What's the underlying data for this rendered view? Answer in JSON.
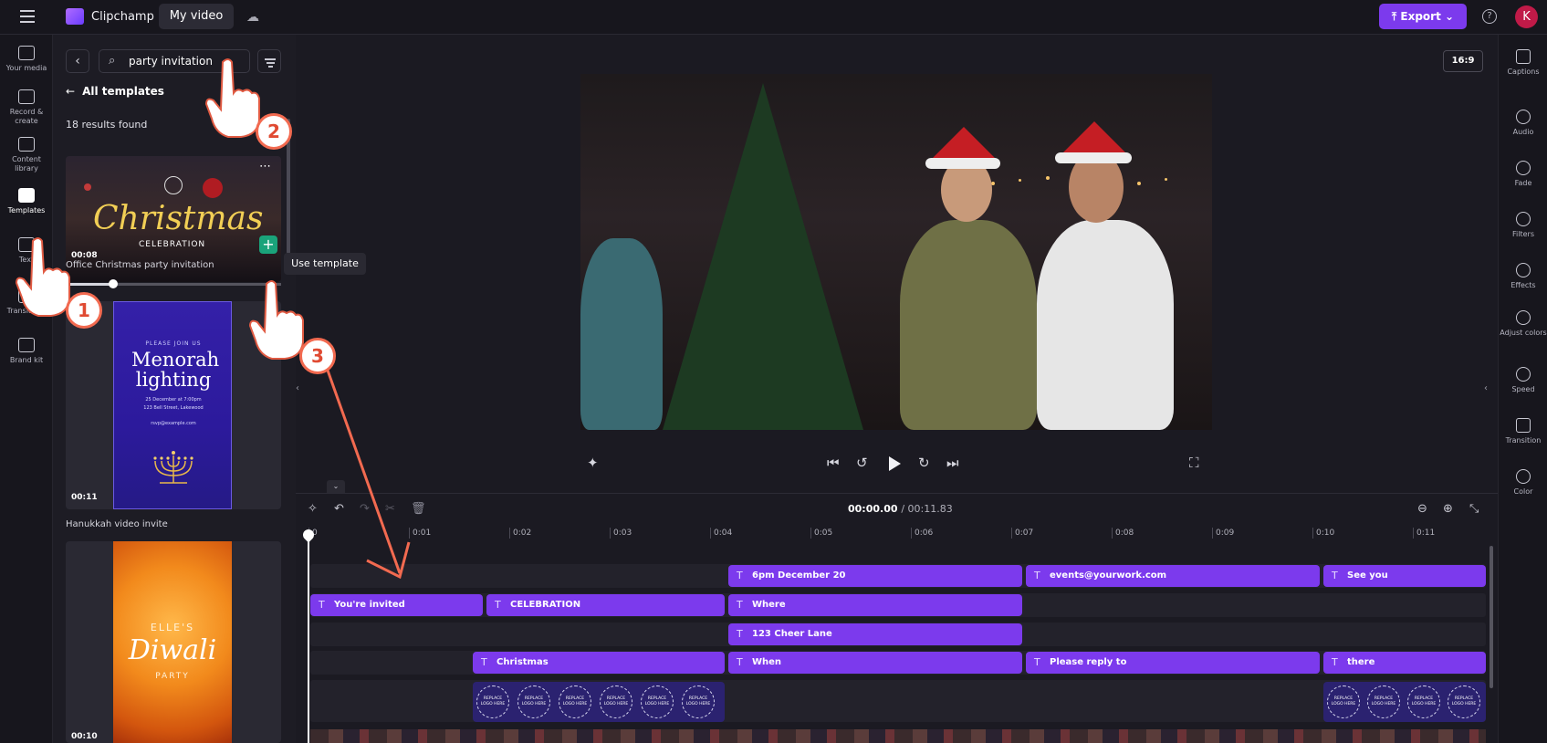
{
  "app": {
    "name": "Clipchamp",
    "project_title": "My video",
    "export_label": "Export",
    "avatar_initial": "K",
    "brand_color": "#7c3aed"
  },
  "left_rail": [
    {
      "label": "Your media"
    },
    {
      "label": "Record & create"
    },
    {
      "label": "Content library"
    },
    {
      "label": "Templates"
    },
    {
      "label": "Text"
    },
    {
      "label": "Transitions"
    },
    {
      "label": "Brand kit"
    }
  ],
  "panel": {
    "search_value": "party invitation",
    "all_templates": "All templates",
    "results": "18 results found",
    "use_template_tooltip": "Use template",
    "cards": [
      {
        "duration": "00:08",
        "label": "Office Christmas party invitation",
        "art_title": "Christmas",
        "art_subtitle": "CELEBRATION",
        "progress": 0.22
      },
      {
        "duration": "00:11",
        "label": "Hanukkah video invite",
        "art_please": "PLEASE JOIN US",
        "art_title": "Menorah lighting",
        "art_line1": "25 December at 7:00pm",
        "art_line2": "123 Bell Street, Lakewood",
        "art_line3": "rsvp@example.com"
      },
      {
        "duration": "00:10",
        "art_top": "ELLE'S",
        "art_title": "Diwali",
        "art_bottom": "PARTY"
      }
    ]
  },
  "preview": {
    "ratio": "16:9"
  },
  "right_rail": [
    {
      "label": "Captions"
    },
    {
      "label": "Audio"
    },
    {
      "label": "Fade"
    },
    {
      "label": "Filters"
    },
    {
      "label": "Effects"
    },
    {
      "label": "Adjust colors"
    },
    {
      "label": "Speed"
    },
    {
      "label": "Transition"
    },
    {
      "label": "Color"
    }
  ],
  "timeline": {
    "current": "00:00.00",
    "total": "/ 00:11.83",
    "ticks": [
      "0",
      "0:01",
      "0:02",
      "0:03",
      "0:04",
      "0:05",
      "0:06",
      "0:07",
      "0:08",
      "0:09",
      "0:10",
      "0:11"
    ],
    "clips": {
      "c1": "6pm December 20",
      "c2": "events@yourwork.com",
      "c3": "See you",
      "c4": "You're invited",
      "c5": "CELEBRATION",
      "c6": "Where",
      "c7": "123 Cheer Lane",
      "c8": "Christmas",
      "c9": "When",
      "c10": "Please reply to",
      "c11": "there"
    },
    "logo_text": "REPLACE LOGO HERE"
  },
  "callouts": [
    "1",
    "2",
    "3"
  ]
}
